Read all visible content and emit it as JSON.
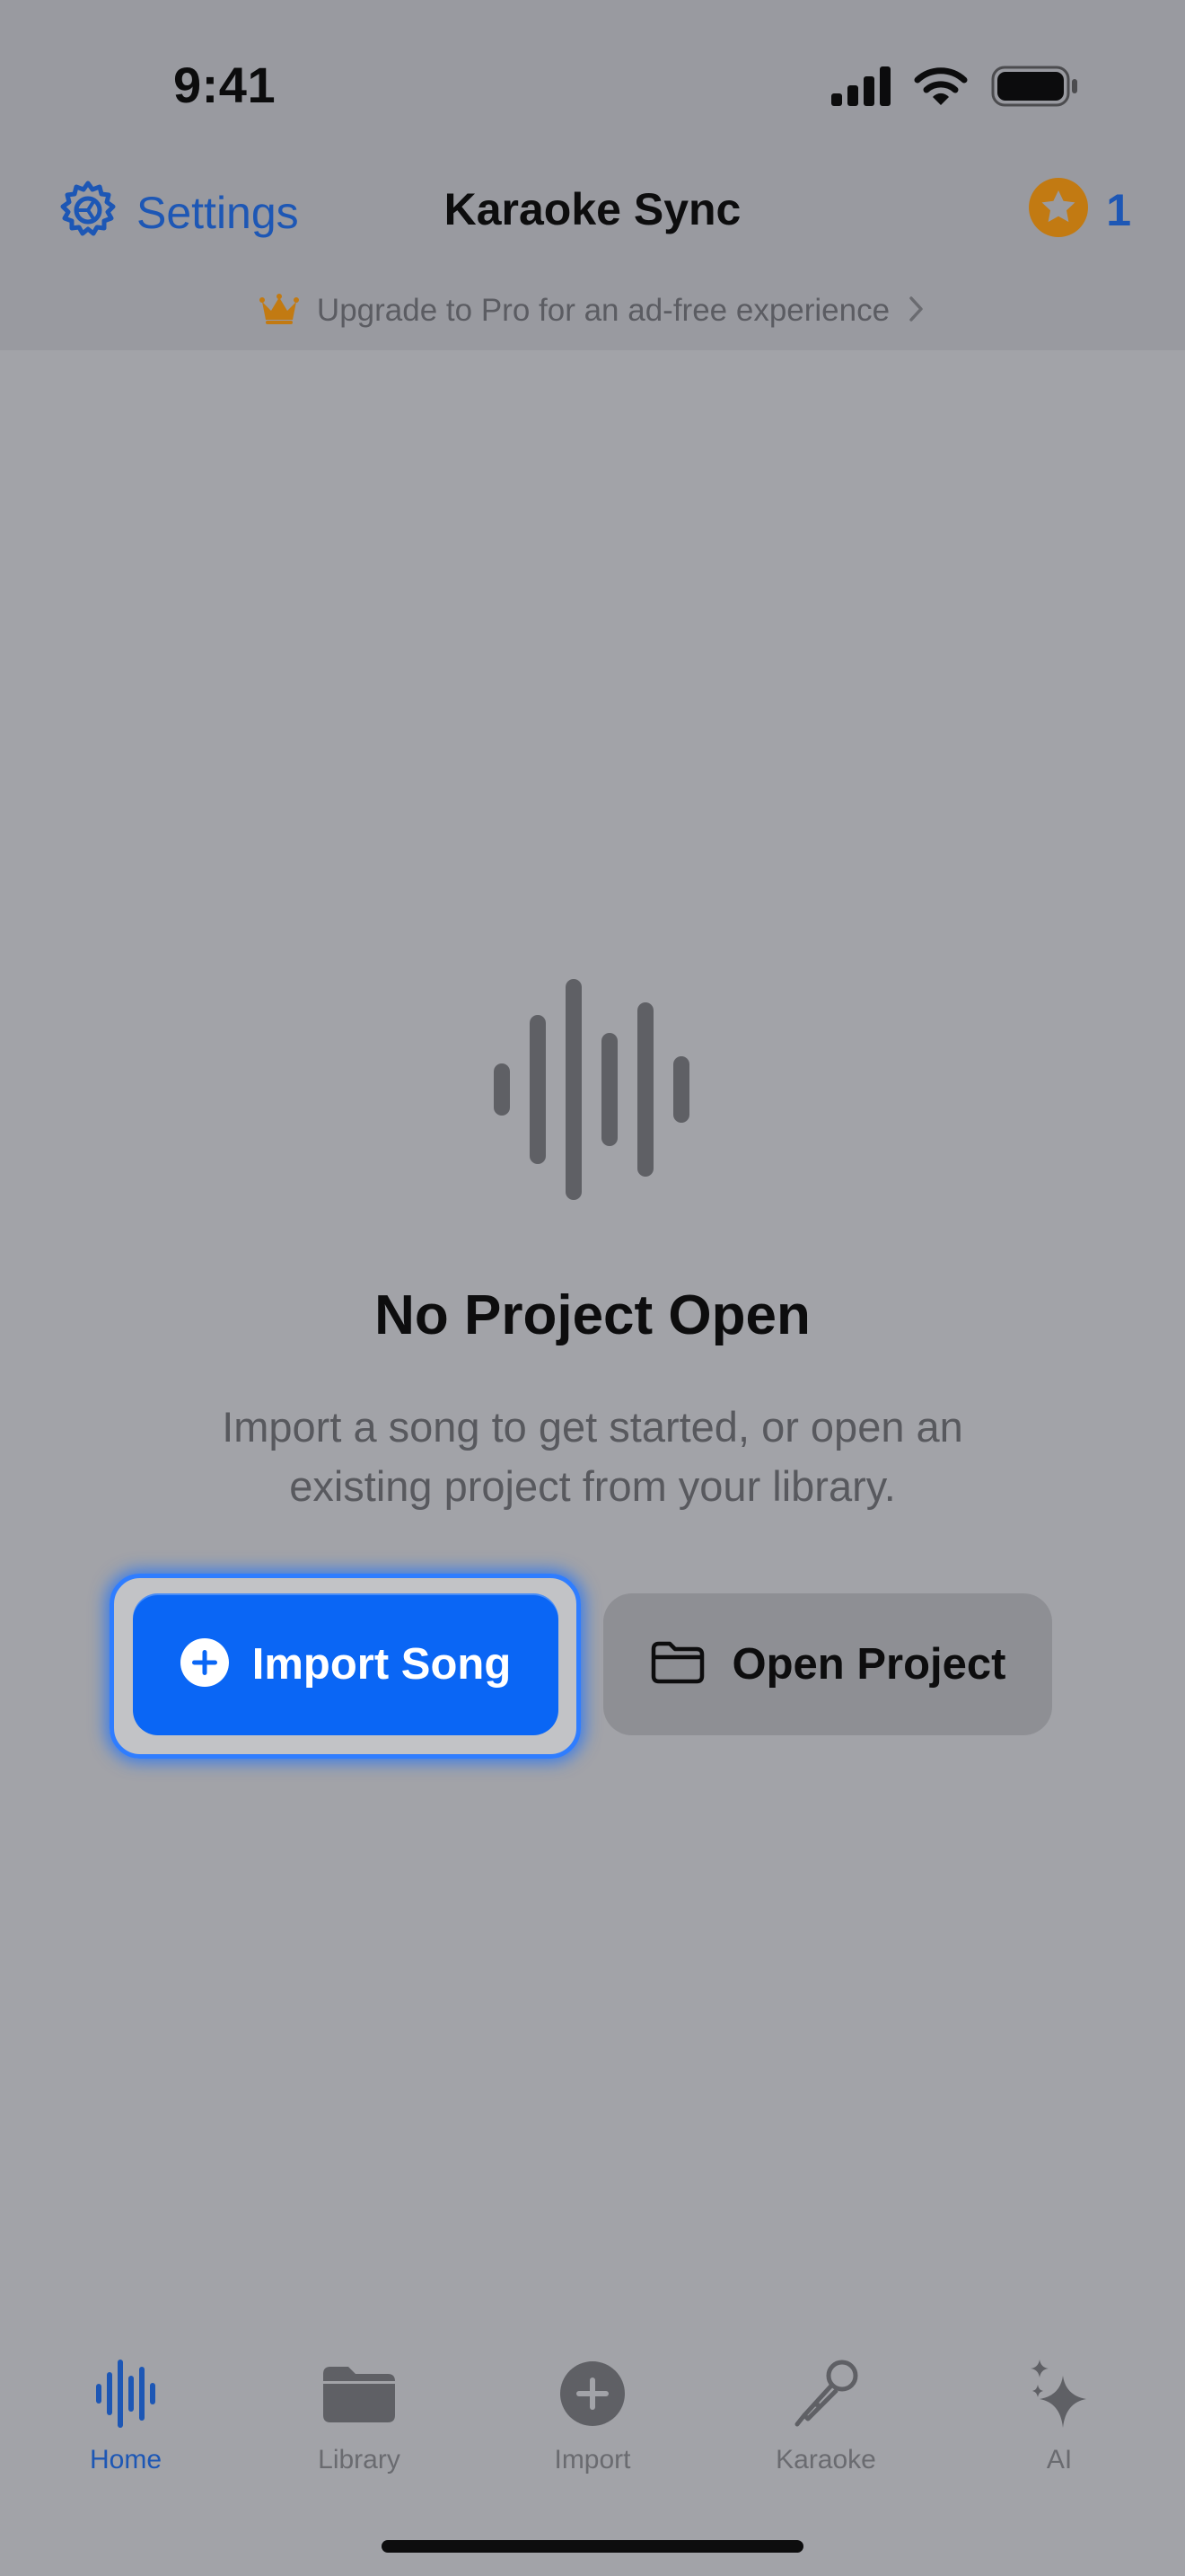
{
  "status_bar": {
    "time": "9:41",
    "icons": [
      "cellular-signal-icon",
      "wifi-icon",
      "battery-icon"
    ]
  },
  "nav_bar": {
    "settings_label": "Settings",
    "title": "Karaoke Sync",
    "points_count": "1",
    "icons": {
      "settings": "gear-icon",
      "points": "star-badge-icon"
    }
  },
  "upgrade_banner": {
    "text": "Upgrade to Pro for an ad-free experience",
    "icons": {
      "leading": "crown-icon",
      "trailing": "chevron-right-icon"
    }
  },
  "empty_state": {
    "icon": "waveform-icon",
    "title": "No Project Open",
    "subtitle": "Import a song to get started, or open an existing project from your library."
  },
  "actions": {
    "import_label": "Import Song",
    "open_label": "Open Project",
    "icons": {
      "import": "plus-circle-icon",
      "open": "folder-icon"
    }
  },
  "tab_bar": {
    "items": [
      {
        "label": "Home",
        "icon": "waveform-icon",
        "active": true
      },
      {
        "label": "Library",
        "icon": "folder-icon",
        "active": false
      },
      {
        "label": "Import",
        "icon": "plus-circle-icon",
        "active": false
      },
      {
        "label": "Karaoke",
        "icon": "microphone-icon",
        "active": false
      },
      {
        "label": "AI",
        "icon": "sparkles-icon",
        "active": false
      }
    ]
  },
  "colors": {
    "accent": "#1d57b5",
    "primary_button": "#0a66f5",
    "crown": "#c27a12",
    "points_badge": "#c27a12"
  }
}
